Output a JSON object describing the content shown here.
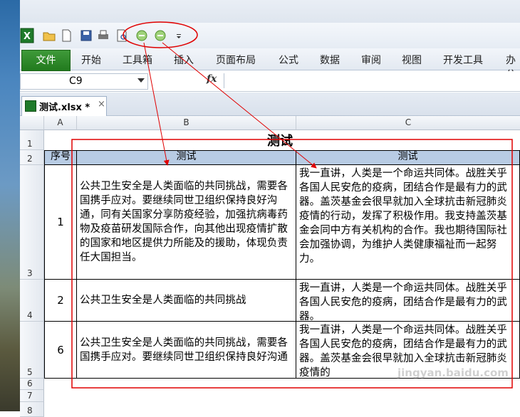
{
  "ribbon": {
    "file_tab": "文件",
    "tabs": [
      "开始",
      "工具箱",
      "插入",
      "页面布局",
      "公式",
      "数据",
      "审阅",
      "视图",
      "开发工具",
      "办公"
    ]
  },
  "formula_bar": {
    "name_box": "C9",
    "fx_label": "fx"
  },
  "document": {
    "tab_label": "测试.xlsx *",
    "close": "×"
  },
  "sheet": {
    "columns": [
      "A",
      "B",
      "C"
    ],
    "rows": [
      "1",
      "2",
      "3",
      "4",
      "5",
      "6",
      "7",
      "8"
    ],
    "title": "测试",
    "header": [
      "序号",
      "测试",
      "测试"
    ],
    "data_rows": [
      {
        "num": "1",
        "b": "公共卫生安全是人类面临的共同挑战，需要各国携手应对。要继续同世卫组织保持良好沟通，同有关国家分享防疫经验，加强抗病毒药物及疫苗研发国际合作，向其他出现疫情扩散的国家和地区提供力所能及的援助，体现负责任大国担当。",
        "c": "我一直讲，人类是一个命运共同体。战胜关乎各国人民安危的疫病，团结合作是最有力的武器。盖茨基金会很早就加入全球抗击新冠肺炎疫情的行动，发挥了积极作用。我支持盖茨基金会同中方有关机构的合作。我也期待国际社会加强协调，为维护人类健康福祉而一起努力。"
      },
      {
        "num": "2",
        "b": "公共卫生安全是人类面临的共同挑战",
        "c": "我一直讲，人类是一个命运共同体。战胜关乎各国人民安危的疫病，团结合作是最有力的武器。"
      },
      {
        "num": "6",
        "b": "公共卫生安全是人类面临的共同挑战，需要各国携手应对。要继续同世卫组织保持良好沟通",
        "c": "我一直讲，人类是一个命运共同体。战胜关乎各国人民安危的疫病，团结合作是最有力的武器。盖茨基金会很早就加入全球抗击新冠肺炎疫情的"
      }
    ]
  },
  "watermark": "jingyan.baidu.com",
  "colors": {
    "header_fill": "#b8cce4",
    "annotation": "#e00000",
    "file_tab": "#2a8a26"
  }
}
